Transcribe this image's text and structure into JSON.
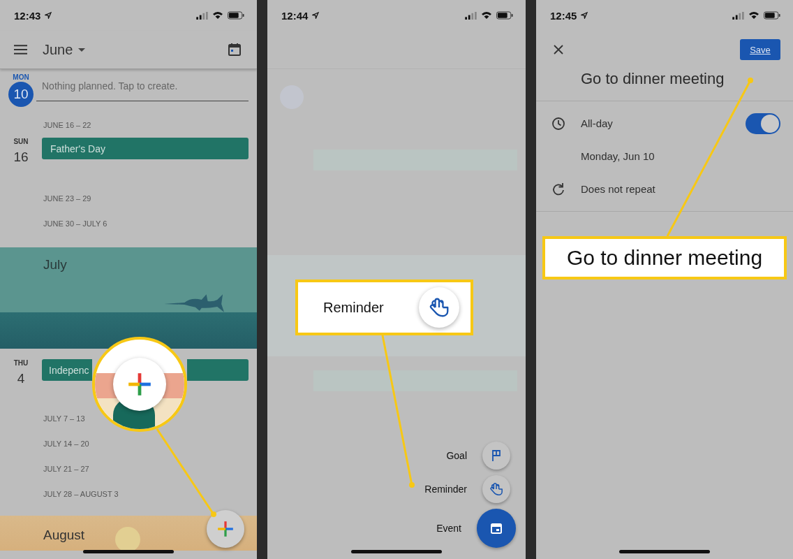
{
  "screens": [
    {
      "kind": "agenda",
      "status_time": "12:43",
      "month": "June",
      "today": {
        "weekday": "MON",
        "day": "10",
        "note": "Nothing planned. Tap to create."
      },
      "items": [
        {
          "kind": "week",
          "label": "JUNE 16 – 22"
        },
        {
          "kind": "event",
          "weekday": "SUN",
          "day": "16",
          "title": "Father's Day"
        },
        {
          "kind": "week",
          "label": "JUNE 23 – 29"
        },
        {
          "kind": "week",
          "label": "JUNE 30 – JULY 6"
        },
        {
          "kind": "ocean",
          "month": "July"
        },
        {
          "kind": "event",
          "weekday": "THU",
          "day": "4",
          "title": "Indepenc"
        },
        {
          "kind": "week",
          "label": "JULY 7 – 13"
        },
        {
          "kind": "week",
          "label": "JULY 14 – 20"
        },
        {
          "kind": "week",
          "label": "JULY 21 – 27"
        },
        {
          "kind": "week",
          "label": "JULY 28 – AUGUST 3"
        },
        {
          "kind": "beach",
          "month": "August"
        }
      ]
    },
    {
      "kind": "menu",
      "status_time": "12:44",
      "callout": {
        "label": "Reminder"
      },
      "actions": [
        {
          "kind": "goal",
          "label": "Goal"
        },
        {
          "kind": "reminder",
          "label": "Reminder"
        },
        {
          "kind": "event",
          "label": "Event"
        }
      ]
    },
    {
      "kind": "edit",
      "status_time": "12:45",
      "save": "Save",
      "title": "Go to dinner meeting",
      "all_day": {
        "label": "All-day",
        "on": true
      },
      "date": "Monday, Jun 10",
      "repeat": "Does not repeat",
      "callout": {
        "label": "Go to dinner meeting"
      }
    }
  ]
}
